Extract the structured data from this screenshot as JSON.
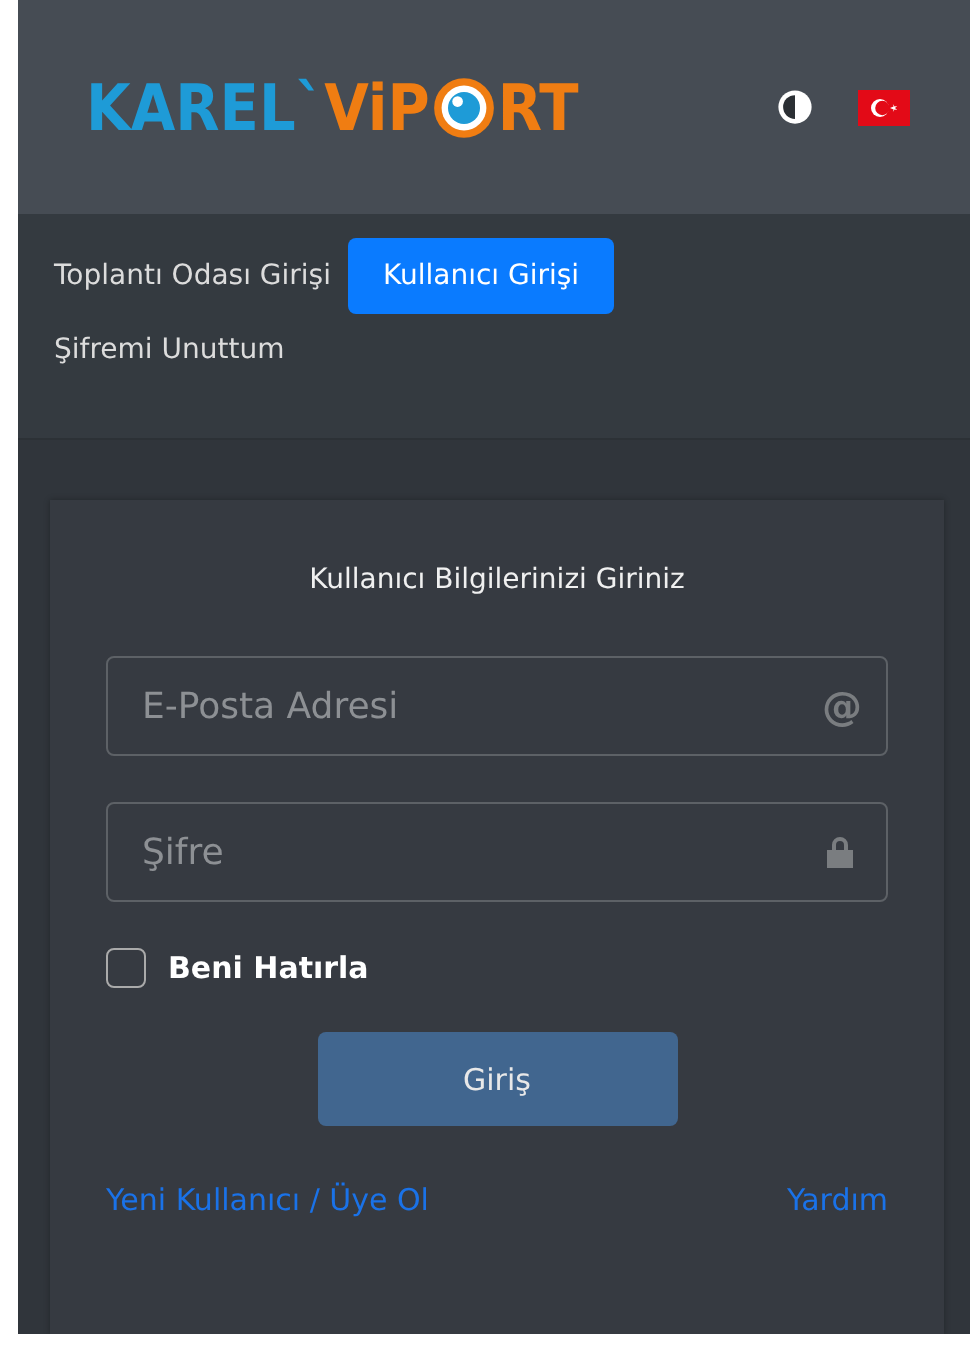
{
  "logo": {
    "parts": [
      {
        "text": "KAREL`",
        "color": "#1e9bd7"
      },
      {
        "text": "ViP",
        "color": "#f07d12"
      },
      {
        "kind": "eye"
      },
      {
        "text": "RT",
        "color": "#f07d12"
      }
    ]
  },
  "tabs": [
    {
      "label": "Toplantı Odası Girişi",
      "selected": false
    },
    {
      "label": "Kullanıcı Girişi",
      "selected": true
    },
    {
      "label": "Şifremi Unuttum",
      "selected": false
    }
  ],
  "form": {
    "heading": "Kullanıcı Bilgilerinizi Giriniz",
    "fields": [
      {
        "placeholder": "E-Posta Adresi",
        "kind": "at",
        "symbol": "@"
      },
      {
        "placeholder": "Şifre",
        "kind": "lock"
      }
    ],
    "remember": {
      "label": "Beni Hatırla",
      "checked": false
    },
    "submit": "Giriş",
    "links": [
      "Yeni Kullanıcı / Üye Ol",
      "Yardım"
    ]
  }
}
